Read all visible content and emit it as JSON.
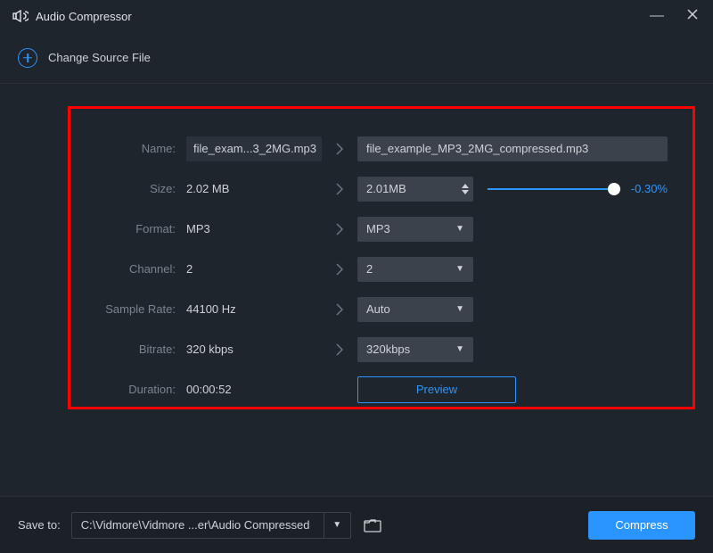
{
  "titlebar": {
    "title": "Audio Compressor"
  },
  "changebar": {
    "label": "Change Source File"
  },
  "labels": {
    "name": "Name:",
    "size": "Size:",
    "format": "Format:",
    "channel": "Channel:",
    "sample_rate": "Sample Rate:",
    "bitrate": "Bitrate:",
    "duration": "Duration:"
  },
  "source": {
    "name": "file_exam...3_2MG.mp3",
    "size": "2.02 MB",
    "format": "MP3",
    "channel": "2",
    "sample_rate": "44100 Hz",
    "bitrate": "320 kbps",
    "duration": "00:00:52"
  },
  "dest": {
    "name": "file_example_MP3_2MG_compressed.mp3",
    "size": "2.01MB",
    "size_pct": "-0.30%",
    "format": "MP3",
    "channel": "2",
    "sample_rate": "Auto",
    "bitrate": "320kbps"
  },
  "preview": {
    "label": "Preview"
  },
  "footer": {
    "save_to_label": "Save to:",
    "path": "C:\\Vidmore\\Vidmore ...er\\Audio Compressed",
    "compress_label": "Compress"
  }
}
